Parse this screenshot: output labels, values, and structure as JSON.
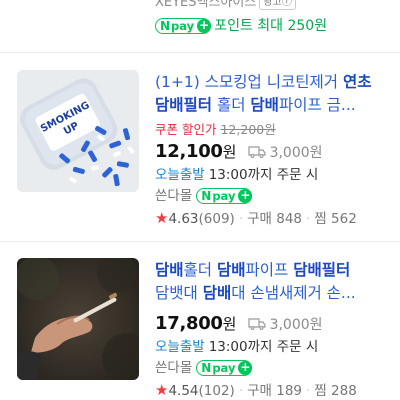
{
  "top_item": {
    "seller": "XEYES엑스아이스",
    "ad_label": "광고ⓘ",
    "npay": {
      "n": "N",
      "pay": "pay",
      "plus": "+"
    },
    "point_text": "포인트 최대 250원"
  },
  "items": [
    {
      "title_parts": [
        "(1+1) 스모킹업 니코틴제거 ",
        "연초",
        " ",
        "담배필터",
        " 홀더 ",
        "담배",
        "파이프 금..."
      ],
      "coupon_label": "쿠폰 할인가",
      "original_price": "12,200원",
      "price": "12,100",
      "price_unit": "원",
      "shipping": "3,000원",
      "delivery_tag": "오늘출발",
      "delivery_text": "13:00까지 주문 시",
      "store": "쓴다몰",
      "npay": {
        "n": "N",
        "pay": "pay",
        "plus": "+"
      },
      "star": "★",
      "rating": "4.63",
      "review_count": "(609)",
      "purchases": "구매 848",
      "wishes": "찜 562"
    },
    {
      "title_parts": [
        "담배",
        "홀더 ",
        "담배",
        "파이프 ",
        "담배필터",
        ""
      ],
      "title_line2_parts": [
        "담뱃대 ",
        "담배",
        "대 손냄새제거 손..."
      ],
      "price": "17,800",
      "price_unit": "원",
      "shipping": "3,000원",
      "delivery_tag": "오늘출발",
      "delivery_text": "13:00까지 주문 시",
      "store": "쓴다몰",
      "npay": {
        "n": "N",
        "pay": "pay",
        "plus": "+"
      },
      "star": "★",
      "rating": "4.54",
      "review_count": "(102)",
      "purchases": "구매 189",
      "wishes": "찜 288"
    }
  ],
  "colors": {
    "title_blue": "#2b5fd1",
    "npay_green": "#03c75a",
    "coupon_red": "#e8273a",
    "today_blue": "#0e86d4",
    "star_red": "#f23d3d"
  }
}
